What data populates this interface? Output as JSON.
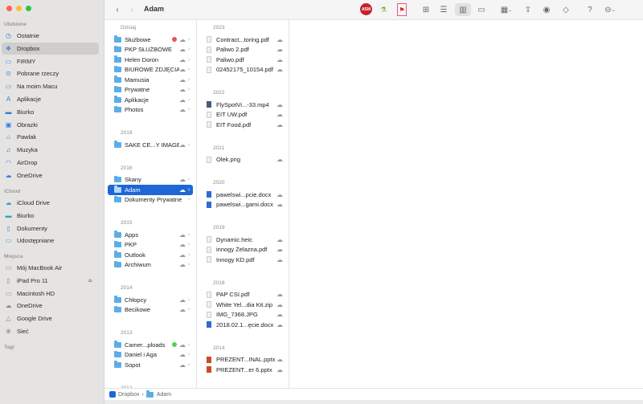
{
  "window": {
    "title": "Adam"
  },
  "sidebar": {
    "favorites_label": "Ulubione",
    "favorites": [
      {
        "label": "Ostatnie",
        "icon": "clock-icon"
      },
      {
        "label": "Dropbox",
        "icon": "dropbox-icon",
        "selected": true
      },
      {
        "label": "FIRMY",
        "icon": "folder-icon"
      },
      {
        "label": "Pobrane rzeczy",
        "icon": "download-icon"
      },
      {
        "label": "Na moim Macu",
        "icon": "folder-icon"
      },
      {
        "label": "Aplikacje",
        "icon": "apps-icon"
      },
      {
        "label": "Biurko",
        "icon": "desktop-icon"
      },
      {
        "label": "Obrazki",
        "icon": "photo-icon"
      },
      {
        "label": "Pawlak",
        "icon": "home-icon"
      },
      {
        "label": "Muzyka",
        "icon": "music-icon"
      },
      {
        "label": "AirDrop",
        "icon": "airdrop-icon"
      },
      {
        "label": "OneDrive",
        "icon": "cloud-icon"
      }
    ],
    "icloud_label": "iCloud",
    "icloud": [
      {
        "label": "iCloud Drive",
        "icon": "cloud-icon"
      },
      {
        "label": "Biurko",
        "icon": "desktop-icon"
      },
      {
        "label": "Dokumenty",
        "icon": "document-icon"
      },
      {
        "label": "Udostępniane",
        "icon": "shared-folder-icon"
      }
    ],
    "places_label": "Miejsca",
    "places": [
      {
        "label": "Mój MacBook Air",
        "icon": "laptop-icon"
      },
      {
        "label": "iPad Pro 11",
        "icon": "ipad-icon"
      },
      {
        "label": "Macintosh HD",
        "icon": "disk-icon"
      },
      {
        "label": "OneDrive",
        "icon": "cloud-icon"
      },
      {
        "label": "Google Drive",
        "icon": "drive-icon"
      },
      {
        "label": "Sieć",
        "icon": "globe-icon"
      }
    ],
    "tags_label": "Tagi"
  },
  "column1": [
    {
      "header": "Dzisiaj",
      "items": [
        {
          "name": "Służbowe",
          "tag": "#f0524f"
        },
        {
          "name": "PKP SŁUŻBOWE"
        },
        {
          "name": "Helen Doron"
        },
        {
          "name": "BIUROWE ZDJĘCIA"
        },
        {
          "name": "Mamusia"
        },
        {
          "name": "Prywatne"
        },
        {
          "name": "Aplikacje"
        },
        {
          "name": "Photos"
        }
      ]
    },
    {
      "header": "2019",
      "items": [
        {
          "name": "SAKE CE...Y IMAGES"
        }
      ]
    },
    {
      "header": "2016",
      "items": [
        {
          "name": "Skany"
        },
        {
          "name": "Adam",
          "selected": true
        },
        {
          "name": "Dokumenty Prywatne",
          "nocloud": true
        }
      ]
    },
    {
      "header": "2015",
      "items": [
        {
          "name": "Apps"
        },
        {
          "name": "PKP"
        },
        {
          "name": "Outlook"
        },
        {
          "name": "Archiwum"
        }
      ]
    },
    {
      "header": "2014",
      "items": [
        {
          "name": "Chłopcy"
        },
        {
          "name": "Becikowe"
        }
      ]
    },
    {
      "header": "2013",
      "items": [
        {
          "name": "Camer...ploads",
          "tag": "#4cd15a"
        },
        {
          "name": "Daniel i Aga"
        },
        {
          "name": "Sopot"
        }
      ]
    },
    {
      "header": "2012",
      "items": []
    }
  ],
  "column2": [
    {
      "header": "2023",
      "items": [
        {
          "name": "Contract...toring.pdf",
          "type": "pdf"
        },
        {
          "name": "Paliwo 2.pdf",
          "type": "pdf"
        },
        {
          "name": "Paliwo.pdf",
          "type": "pdf"
        },
        {
          "name": "02452175_10154.pdf",
          "type": "pdf"
        }
      ]
    },
    {
      "header": "2022",
      "items": [
        {
          "name": "FlySpotVi...-33.mp4",
          "type": "vid"
        },
        {
          "name": "EIT UW.pdf",
          "type": "pdf"
        },
        {
          "name": "EIT Food.pdf",
          "type": "pdf"
        }
      ]
    },
    {
      "header": "2021",
      "items": [
        {
          "name": "Olek.png",
          "type": "pdf"
        }
      ]
    },
    {
      "header": "2020",
      "items": [
        {
          "name": "pawelswi...pcie.docx",
          "type": "doc"
        },
        {
          "name": "pawelswi...gami.docx",
          "type": "doc"
        }
      ]
    },
    {
      "header": "2019",
      "items": [
        {
          "name": "Dynamic.heic",
          "type": "pdf"
        },
        {
          "name": "innogy Żelazna.pdf",
          "type": "pdf"
        },
        {
          "name": "Innogy KD.pdf",
          "type": "pdf"
        }
      ]
    },
    {
      "header": "2018",
      "items": [
        {
          "name": "PAP CSI.pdf",
          "type": "pdf"
        },
        {
          "name": "White Yel...dia Kit.zip",
          "type": "zip"
        },
        {
          "name": "IMG_7368.JPG",
          "type": "pdf"
        },
        {
          "name": "2018.02.1...ęcie.docx",
          "type": "doc"
        }
      ]
    },
    {
      "header": "2014",
      "items": [
        {
          "name": "PREZENT...INAL.pptx",
          "type": "ppt"
        },
        {
          "name": "PREZENT...er 6.pptx",
          "type": "ppt"
        }
      ]
    }
  ],
  "pathbar": {
    "items": [
      "Dropbox",
      "Adam"
    ],
    "separator": "›"
  },
  "colors": {
    "accent": "#1e67d6",
    "sidebar_bg": "#e6e4e2"
  }
}
